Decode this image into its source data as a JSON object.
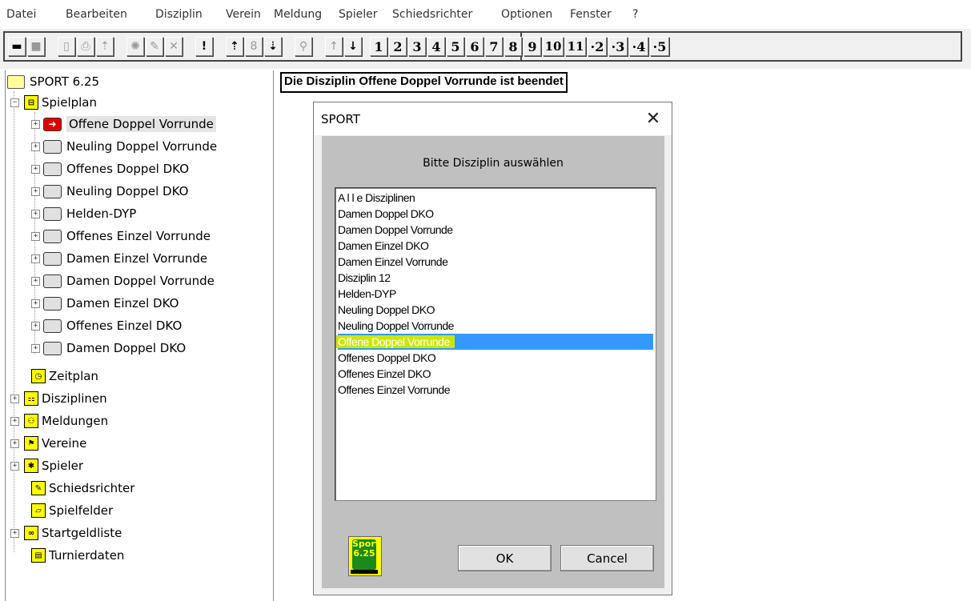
{
  "menubar": [
    "Datei",
    "Bearbeiten",
    "Disziplin",
    "Verein",
    "Meldung",
    "Spieler",
    "Schiedsrichter",
    "Optionen",
    "Fenster",
    "?"
  ],
  "toolbar": {
    "number_buttons": [
      "1",
      "2",
      "3",
      "4",
      "5",
      "6",
      "7",
      "8",
      "9",
      "10",
      "11",
      "·2",
      "·3",
      "·4",
      "·5"
    ]
  },
  "tree": {
    "root": "SPORT 6.25",
    "spielplan": "Spielplan",
    "disciplines": [
      "Offene Doppel Vorrunde",
      "Neuling Doppel Vorrunde",
      "Offenes Doppel DKO",
      "Neuling Doppel DKO",
      "Helden-DYP",
      "Offenes Einzel Vorrunde",
      "Damen Einzel Vorrunde",
      "Damen Doppel Vorrunde",
      "Damen Einzel DKO",
      "Offenes Einzel DKO",
      "Damen Doppel DKO"
    ],
    "sections": [
      "Zeitplan",
      "Disziplinen",
      "Meldungen",
      "Vereine",
      "Spieler",
      "Schiedsrichter",
      "Spielfelder",
      "Startgeldliste",
      "Turnierdaten"
    ]
  },
  "status_message": "Die Disziplin Offene Doppel Vorrunde ist beendet",
  "dialog": {
    "title": "SPORT",
    "prompt": "Bitte Disziplin auswählen",
    "items": [
      "A l l e Disziplinen",
      "Damen Doppel DKO",
      "Damen Doppel Vorrunde",
      "Damen Einzel DKO",
      "Damen Einzel Vorrunde",
      "Disziplin 12",
      "Helden-DYP",
      "Neuling Doppel DKO",
      "Neuling Doppel Vorrunde",
      "Offene Doppel Vorrunde",
      "Offenes Doppel DKO",
      "Offenes Einzel DKO",
      "Offenes Einzel Vorrunde"
    ],
    "selected_item": "Offene Doppel Vorrunde",
    "ok_label": "OK",
    "cancel_label": "Cancel",
    "logo_text": "Sport 6.25"
  },
  "colors": {
    "selection": "#3399ff",
    "highlight": "#cce600",
    "icon_yellow": "#ffff00",
    "active_red": "#e00000"
  }
}
